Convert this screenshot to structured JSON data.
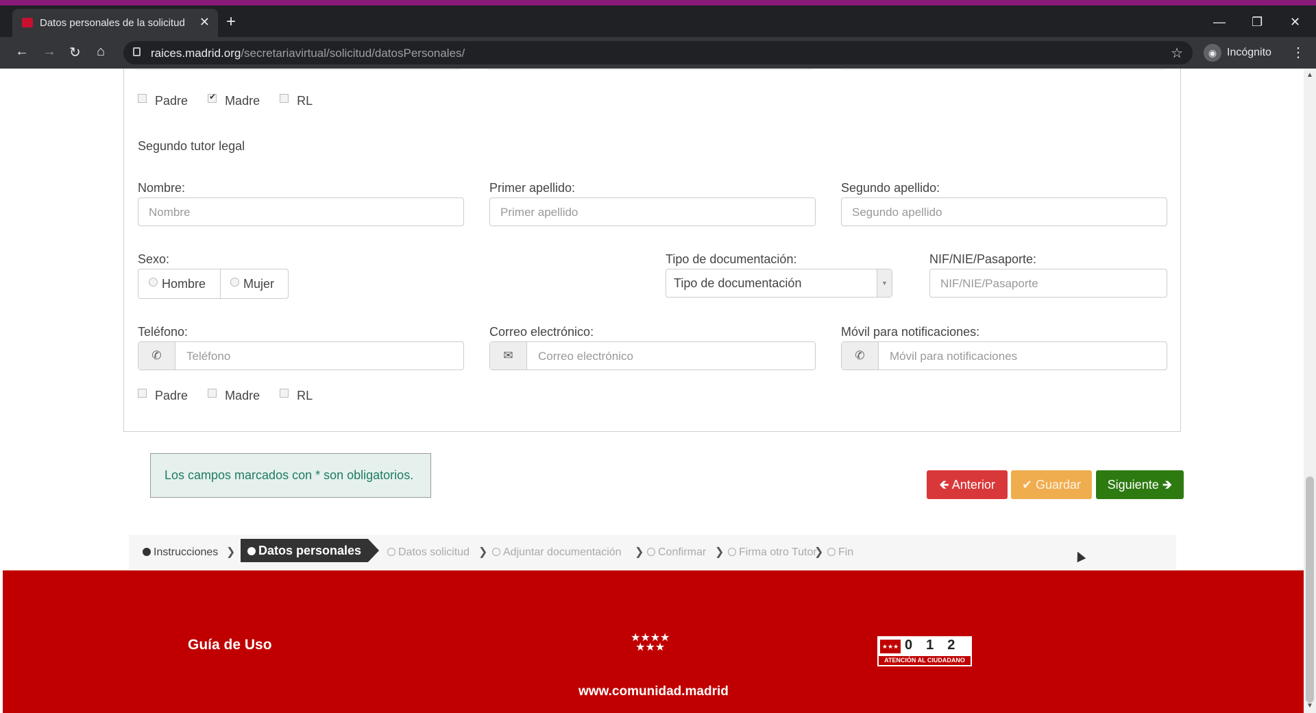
{
  "browser": {
    "tab_title": "Datos personales de la solicitud",
    "tab_close": "✕",
    "new_tab": "+",
    "url_host": "raices.madrid.org",
    "url_path": "/secretariavirtual/solicitud/datosPersonales/",
    "incognito_label": "Incógnito",
    "win_min": "—",
    "win_max": "❐",
    "win_close": "✕"
  },
  "first_tutor_roles": [
    {
      "label": "Padre",
      "checked": false
    },
    {
      "label": "Madre",
      "checked": true
    },
    {
      "label": "RL",
      "checked": false
    }
  ],
  "second_tutor": {
    "section_title": "Segundo tutor legal",
    "nombre": {
      "label": "Nombre:",
      "placeholder": "Nombre"
    },
    "primer_apellido": {
      "label": "Primer apellido:",
      "placeholder": "Primer apellido"
    },
    "segundo_apellido": {
      "label": "Segundo apellido:",
      "placeholder": "Segundo apellido"
    },
    "sexo": {
      "label": "Sexo:",
      "options": [
        "Hombre",
        "Mujer"
      ]
    },
    "tipo_doc": {
      "label": "Tipo de documentación:",
      "selected": "Tipo de documentación"
    },
    "nif": {
      "label": "NIF/NIE/Pasaporte:",
      "placeholder": "NIF/NIE/Pasaporte"
    },
    "telefono": {
      "label": "Teléfono:",
      "placeholder": "Teléfono",
      "icon": "phone-icon"
    },
    "correo": {
      "label": "Correo electrónico:",
      "placeholder": "Correo electrónico",
      "icon": "envelope-icon"
    },
    "movil": {
      "label": "Móvil para notificaciones:",
      "placeholder": "Móvil para notificaciones",
      "icon": "phone-icon"
    },
    "roles": [
      {
        "label": "Padre",
        "checked": false
      },
      {
        "label": "Madre",
        "checked": false
      },
      {
        "label": "RL",
        "checked": false
      }
    ]
  },
  "notice": "Los campos marcados con * son obligatorios.",
  "buttons": {
    "anterior": "🡸 Anterior",
    "guardar": "✔ Guardar",
    "siguiente": "Siguiente 🡺"
  },
  "steps": [
    {
      "label": "Instrucciones",
      "state": "done"
    },
    {
      "label": "Datos personales",
      "state": "active"
    },
    {
      "label": "Datos solicitud",
      "state": "pending"
    },
    {
      "label": "Adjuntar documentación",
      "state": "pending"
    },
    {
      "label": "Confirmar",
      "state": "pending"
    },
    {
      "label": "Firma otro Tutor",
      "state": "pending"
    },
    {
      "label": "Fin",
      "state": "pending"
    }
  ],
  "footer": {
    "guia": "Guía de Uso",
    "web": "www.comunidad.madrid",
    "logo_digits": "012",
    "logo_text": "ATENCIÓN AL CIUDADANO"
  },
  "colors": {
    "brand_red": "#c00000",
    "btn_anterior": "#d9383a",
    "btn_guardar": "#f0ad4e",
    "btn_siguiente": "#2d7a10"
  }
}
